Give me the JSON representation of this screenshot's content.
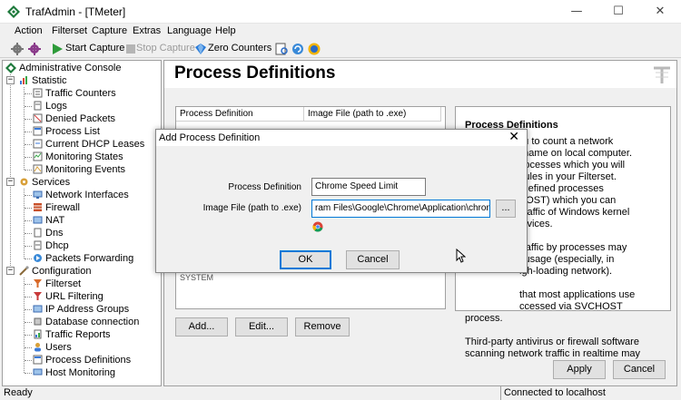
{
  "window": {
    "title": "TrafAdmin - [TMeter]",
    "minimize": "—",
    "maximize": "☐",
    "close": "✕"
  },
  "menu": [
    "Action",
    "Filterset",
    "Capture",
    "Extras",
    "Language",
    "Help"
  ],
  "toolbar": {
    "start_capture": "Start Capture",
    "stop_capture": "Stop Capture",
    "zero_counters": "Zero Counters"
  },
  "sidebar": {
    "root": "Administrative Console",
    "groups": [
      {
        "label": "Statistic",
        "items": [
          "Traffic Counters",
          "Logs",
          "Denied Packets",
          "Process List",
          "Current DHCP Leases",
          "Monitoring States",
          "Monitoring Events"
        ]
      },
      {
        "label": "Services",
        "items": [
          "Network Interfaces",
          "Firewall",
          "NAT",
          "Dns",
          "Dhcp",
          "Packets Forwarding"
        ]
      },
      {
        "label": "Configuration",
        "items": [
          "Filterset",
          "URL Filtering",
          "IP Address Groups",
          "Database connection",
          "Traffic Reports",
          "Users",
          "Process Definitions",
          "Host Monitoring"
        ]
      }
    ]
  },
  "main": {
    "title": "Process Definitions",
    "columns": [
      "Process Definition",
      "Image File (path to .exe)"
    ],
    "rows": [
      "SYSTEM"
    ],
    "buttons": {
      "add": "Add...",
      "edit": "Edit...",
      "remove": "Remove"
    },
    "apply": "Apply",
    "cancel": "Cancel",
    "info_title": "Process Definitions",
    "info_lines": [
      "s you to count a network",
      "ess name on local computer.",
      "st processes which you will",
      "ing rules in your Filterset.",
      "pre-defined processes",
      "VCHOST) which you can",
      "ing traffic of Windows kernel",
      "n services.",
      "",
      "traffic by processes may",
      "l usage (especially, in",
      "igh-loading network).",
      "",
      "that most applications use",
      "ccessed via SVCHOST",
      "process.",
      "",
      "Third-party antivirus or firewall software",
      "scanning network traffic in realtime may"
    ]
  },
  "dialog": {
    "title": "Add Process Definition",
    "close": "✕",
    "process_definition_label": "Process Definition",
    "process_definition_value": "Chrome Speed Limit",
    "image_file_label": "Image File (path to .exe)",
    "image_file_value": "ram Files\\Google\\Chrome\\Application\\chrome.exe",
    "browse": "...",
    "ok": "OK",
    "cancel": "Cancel"
  },
  "status": {
    "left": "Ready",
    "right": "Connected to localhost"
  },
  "colors": {
    "accent": "#0078d7",
    "start_icon": "#2e9b3a",
    "zero_icon": "#2a7bd8"
  }
}
